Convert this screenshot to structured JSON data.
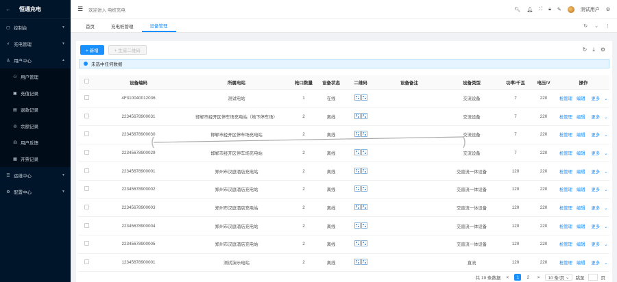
{
  "app": {
    "title": "恒通充电"
  },
  "sidebar": {
    "items": [
      {
        "label": "控制台",
        "icon": "dashboard-icon"
      },
      {
        "label": "充电管理",
        "icon": "charge-icon"
      },
      {
        "label": "用户中心",
        "icon": "user-icon"
      },
      {
        "label": "用户管理",
        "icon": "users-icon"
      },
      {
        "label": "充值记录",
        "icon": "record-icon"
      },
      {
        "label": "退款记录",
        "icon": "refund-icon"
      },
      {
        "label": "余额记录",
        "icon": "balance-icon"
      },
      {
        "label": "用户反馈",
        "icon": "feedback-icon"
      },
      {
        "label": "开票记录",
        "icon": "invoice-icon"
      },
      {
        "label": "运维中心",
        "icon": "ops-icon"
      },
      {
        "label": "配置中心",
        "icon": "config-icon"
      }
    ]
  },
  "header": {
    "welcome": "欢迎进入 电桩充电",
    "username": "测试用户"
  },
  "tabs": [
    {
      "label": "首页"
    },
    {
      "label": "充电桩管理"
    },
    {
      "label": "设备管理"
    }
  ],
  "toolbar": {
    "add_label": "+ 新增",
    "qr_label": "+ 生成二维码"
  },
  "alert": {
    "text": "未选中任何数据"
  },
  "table": {
    "headers": [
      "设备编码",
      "所属电站",
      "枪口数量",
      "设备状态",
      "二维码",
      "设备备注",
      "设备类型",
      "功率/千瓦",
      "电压/V",
      "操作"
    ],
    "ops": {
      "gun": "枪管理",
      "edit": "编辑",
      "more": "更多"
    },
    "rows": [
      {
        "code": "4F310040012036",
        "station": "测试电站",
        "guns": "1",
        "status": "在线",
        "note": "",
        "type": "交流设备",
        "power": "7",
        "voltage": "220"
      },
      {
        "code": "22345678900031",
        "station": "邯郸市经开区停车场充电站（地下停车场）",
        "guns": "2",
        "status": "离线",
        "note": "",
        "type": "交流设备",
        "power": "7",
        "voltage": "220"
      },
      {
        "code": "22345678900030",
        "station": "邯郸市经开区停车场充电站",
        "guns": "2",
        "status": "离线",
        "note": "",
        "type": "交流设备",
        "power": "7",
        "voltage": "220"
      },
      {
        "code": "22345678900029",
        "station": "邯郸市经开区停车场充电站",
        "guns": "2",
        "status": "离线",
        "note": "",
        "type": "交流设备",
        "power": "7",
        "voltage": "220"
      },
      {
        "code": "22345678900001",
        "station": "郑州市汉庭酒店充电站",
        "guns": "2",
        "status": "离线",
        "note": "",
        "type": "交直流一体设备",
        "power": "120",
        "voltage": "220"
      },
      {
        "code": "22345678900002",
        "station": "郑州市汉庭酒店充电站",
        "guns": "2",
        "status": "离线",
        "note": "",
        "type": "交直流一体设备",
        "power": "120",
        "voltage": "220"
      },
      {
        "code": "22345678900003",
        "station": "郑州市汉庭酒店充电站",
        "guns": "2",
        "status": "离线",
        "note": "",
        "type": "交直流一体设备",
        "power": "120",
        "voltage": "220"
      },
      {
        "code": "22345678900004",
        "station": "郑州市汉庭酒店充电站",
        "guns": "2",
        "status": "离线",
        "note": "",
        "type": "交直流一体设备",
        "power": "120",
        "voltage": "220"
      },
      {
        "code": "22345678900005",
        "station": "郑州市汉庭酒店充电站",
        "guns": "2",
        "status": "离线",
        "note": "",
        "type": "交直流一体设备",
        "power": "120",
        "voltage": "220"
      },
      {
        "code": "12345678900001",
        "station": "测试演示电站",
        "guns": "2",
        "status": "离线",
        "note": "",
        "type": "直流",
        "power": "120",
        "voltage": "220"
      }
    ]
  },
  "pagination": {
    "total": "共 19 条数据",
    "pages": [
      "1",
      "2"
    ],
    "prev": "<",
    "next": ">",
    "page_size": "10 条/页",
    "jump_label": "跳至",
    "jump_unit": "页"
  }
}
